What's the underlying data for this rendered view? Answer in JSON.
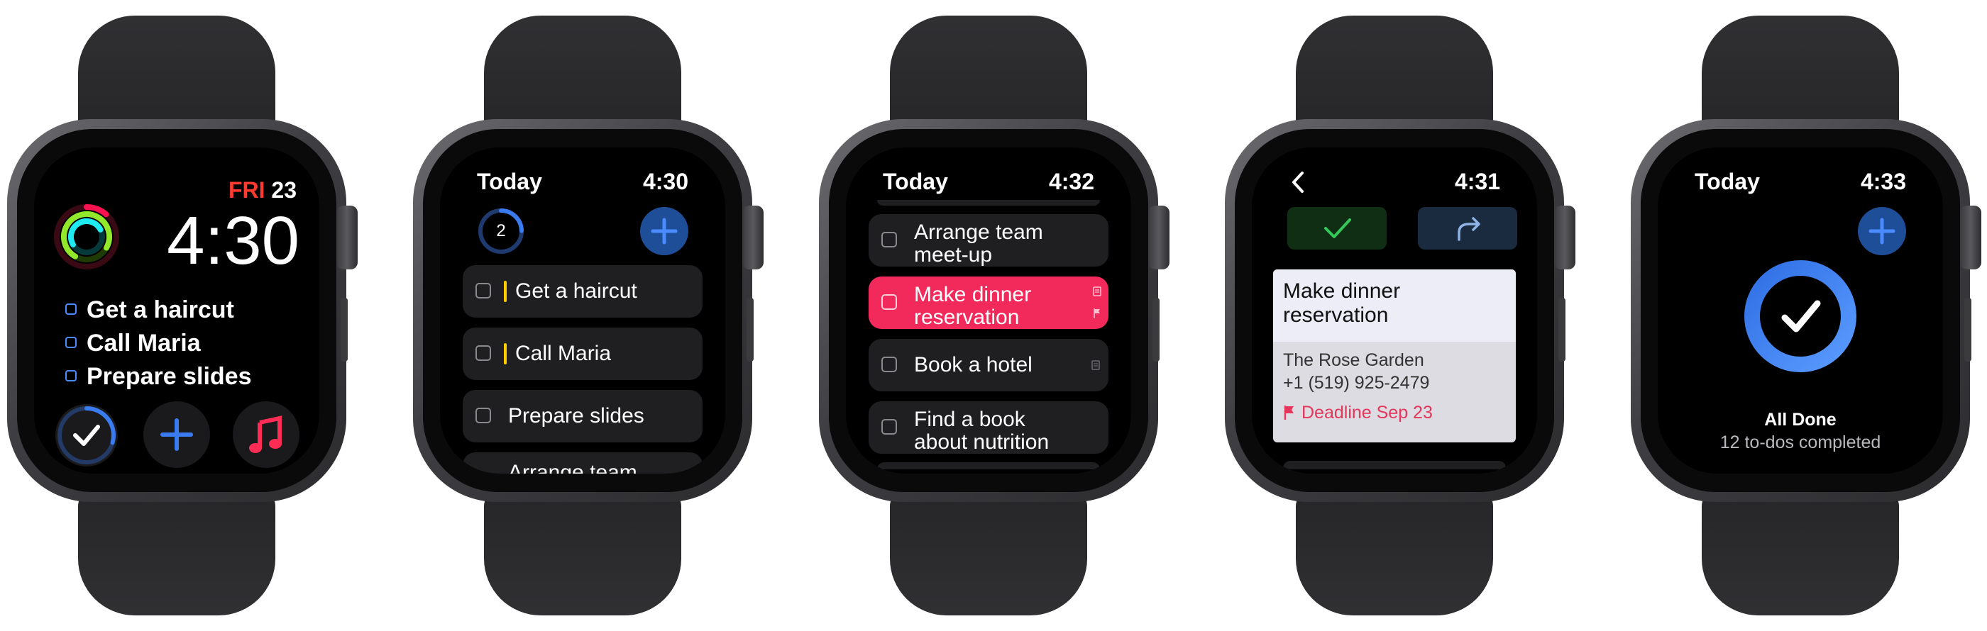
{
  "watches": [
    {
      "complications": {
        "day": "FRI",
        "date": "23",
        "time": "4:30",
        "tasks": [
          "Get a haircut",
          "Call Maria",
          "Prepare slides"
        ]
      }
    },
    {
      "title": "Today",
      "time": "4:30",
      "badge_count": "2",
      "items": [
        "Get a haircut",
        "Call Maria",
        "Prepare slides",
        "Arrange team"
      ]
    },
    {
      "title": "Today",
      "time": "4:32",
      "items": [
        "Arrange team\nmeet-up",
        "Make dinner\nreservation",
        "Book a hotel",
        "Find a book\nabout nutrition"
      ]
    },
    {
      "time": "4:31",
      "task_title": "Make dinner\nreservation",
      "notes_line1": "The Rose Garden",
      "notes_line2": "+1 (519) 925-2479",
      "deadline": "Deadline Sep 23"
    },
    {
      "title": "Today",
      "time": "4:33",
      "done_title": "All Done",
      "done_subtitle": "12 to-dos completed"
    }
  ],
  "colors": {
    "accent_blue": "#3b7bf0",
    "highlight_red": "#f2295b",
    "complete_green": "#34c759",
    "date_red": "#ff3b30"
  }
}
